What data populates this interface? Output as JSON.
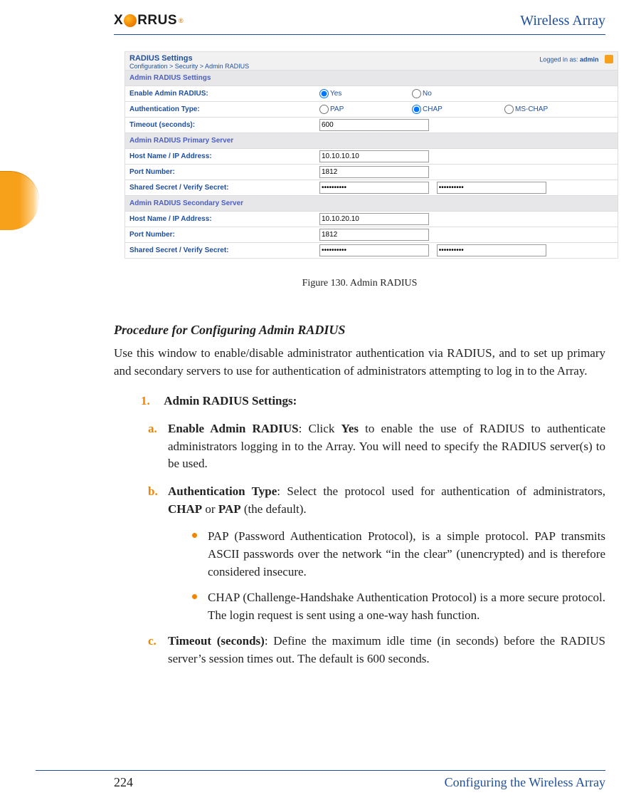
{
  "header": {
    "logo_text_left": "X",
    "logo_text_right": "RRUS",
    "doc_title": "Wireless Array"
  },
  "screenshot": {
    "title": "RADIUS Settings",
    "breadcrumb": "Configuration > Security > Admin RADIUS",
    "logged_in_prefix": "Logged in as: ",
    "logged_in_user": "admin",
    "section_settings": "Admin RADIUS Settings",
    "row_enable": "Enable Admin RADIUS:",
    "opt_yes": "Yes",
    "opt_no": "No",
    "row_auth": "Authentication Type:",
    "opt_pap": "PAP",
    "opt_chap": "CHAP",
    "opt_mschap": "MS-CHAP",
    "row_timeout": "Timeout (seconds):",
    "val_timeout": "600",
    "section_primary": "Admin RADIUS Primary Server",
    "row_host": "Host Name / IP Address:",
    "val_host1": "10.10.10.10",
    "row_port": "Port Number:",
    "val_port1": "1812",
    "row_secret": "Shared Secret / Verify Secret:",
    "val_secret": "••••••••••",
    "section_secondary": "Admin RADIUS Secondary Server",
    "val_host2": "10.10.20.10",
    "val_port2": "1812"
  },
  "figure_caption": "Figure 130. Admin RADIUS",
  "subhead": "Procedure for Configuring Admin RADIUS",
  "intro": "Use this window to enable/disable administrator authentication via RADIUS, and to set up primary and secondary servers to use for authentication of administrators attempting to log in to the Array.",
  "step1_num": "1.",
  "step1_title": "Admin RADIUS Settings:",
  "a_let": "a.",
  "a_bold": "Enable Admin RADIUS",
  "a_text_1": ": Click ",
  "a_yes": "Yes",
  "a_text_2": " to enable the use of RADIUS to authenticate administrators logging in to the Array. You will need to specify the RADIUS server(s) to be used.",
  "b_let": "b.",
  "b_bold": "Authentication Type",
  "b_text_1": ": Select the protocol used for authentication of administrators, ",
  "b_chap": "CHAP",
  "b_or": " or ",
  "b_pap": "PAP",
  "b_text_2": " (the default).",
  "bullet1": "PAP (Password Authentication Protocol), is a simple protocol. PAP transmits ASCII passwords over the network “in the clear” (unencrypted) and is therefore considered insecure.",
  "bullet2": "CHAP (Challenge-Handshake Authentication Protocol) is a more secure protocol. The login request is sent using a one-way hash function.",
  "c_let": "c.",
  "c_bold": "Timeout (seconds)",
  "c_text": ": Define the maximum idle time (in seconds) before the RADIUS server’s session times out. The default is 600 seconds.",
  "footer_page": "224",
  "footer_text": "Configuring the Wireless Array"
}
